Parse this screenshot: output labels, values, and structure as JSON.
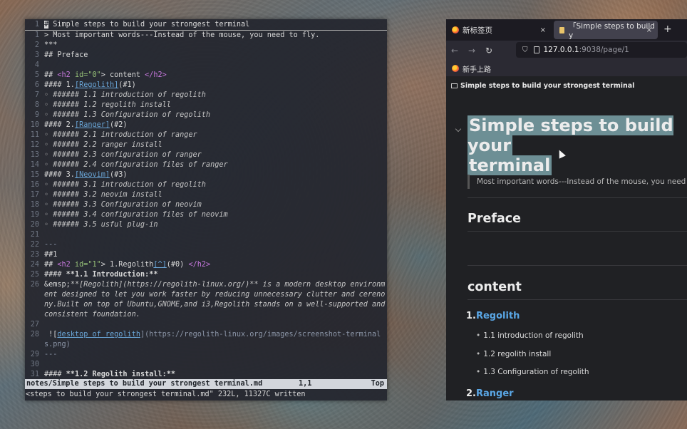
{
  "editor": {
    "lines": [
      {
        "n": "1",
        "segs": [
          [
            "#",
            "cur"
          ],
          [
            " Simple steps to build your strongest terminal",
            ""
          ]
        ],
        "cursor_line": true
      },
      {
        "n": "1",
        "segs": [
          [
            "> Most important words---Instead of the mouse, you need to fly.",
            ""
          ]
        ]
      },
      {
        "n": "2",
        "segs": [
          [
            "***",
            ""
          ]
        ]
      },
      {
        "n": "3",
        "segs": [
          [
            "## Preface",
            ""
          ]
        ]
      },
      {
        "n": "4",
        "segs": [
          [
            "",
            ""
          ]
        ]
      },
      {
        "n": "5",
        "segs": [
          [
            "## ",
            ""
          ],
          [
            "<h2 ",
            "tag"
          ],
          [
            "id=",
            "attr"
          ],
          [
            "\"0\"",
            "attr"
          ],
          [
            "> content ",
            ""
          ],
          [
            "</h2>",
            "tag"
          ]
        ]
      },
      {
        "n": "6",
        "segs": [
          [
            "#### 1.",
            ""
          ],
          [
            "[Regolith]",
            "link"
          ],
          [
            "(#1)",
            ""
          ]
        ]
      },
      {
        "n": "7",
        "segs": [
          [
            "◦ ###### 1.1 introduction of regolith",
            "ital"
          ]
        ]
      },
      {
        "n": "8",
        "segs": [
          [
            "◦ ###### 1.2 regolith install",
            "ital"
          ]
        ]
      },
      {
        "n": "9",
        "segs": [
          [
            "◦ ###### 1.3 Configuration of regolith",
            "ital"
          ]
        ]
      },
      {
        "n": "10",
        "segs": [
          [
            "#### 2.",
            ""
          ],
          [
            "[Ranger]",
            "link"
          ],
          [
            "(#2)",
            ""
          ]
        ]
      },
      {
        "n": "11",
        "segs": [
          [
            "◦ ###### 2.1 introduction of ranger",
            "ital"
          ]
        ]
      },
      {
        "n": "12",
        "segs": [
          [
            "◦ ###### 2.2 ranger install",
            "ital"
          ]
        ]
      },
      {
        "n": "13",
        "segs": [
          [
            "◦ ###### 2.3 configuration of ranger",
            "ital"
          ]
        ]
      },
      {
        "n": "14",
        "segs": [
          [
            "◦ ###### 2.4 configuration files of ranger",
            "ital"
          ]
        ]
      },
      {
        "n": "15",
        "segs": [
          [
            "#### 3.",
            ""
          ],
          [
            "[Neovim]",
            "link"
          ],
          [
            "(#3)",
            ""
          ]
        ]
      },
      {
        "n": "16",
        "segs": [
          [
            "◦ ###### 3.1 introduction of regolith",
            "ital"
          ]
        ]
      },
      {
        "n": "17",
        "segs": [
          [
            "◦ ###### 3.2 neovim install",
            "ital"
          ]
        ]
      },
      {
        "n": "18",
        "segs": [
          [
            "◦ ###### 3.3 Configuration of neovim",
            "ital"
          ]
        ]
      },
      {
        "n": "19",
        "segs": [
          [
            "◦ ###### 3.4 configuration files of neovim",
            "ital"
          ]
        ]
      },
      {
        "n": "20",
        "segs": [
          [
            "◦ ###### 3.5 usful plug-in",
            "ital"
          ]
        ]
      },
      {
        "n": "21",
        "segs": [
          [
            "",
            ""
          ]
        ]
      },
      {
        "n": "22",
        "segs": [
          [
            "---",
            "dim"
          ]
        ]
      },
      {
        "n": "23",
        "segs": [
          [
            "##1",
            ""
          ]
        ]
      },
      {
        "n": "24",
        "segs": [
          [
            "## ",
            ""
          ],
          [
            "<h2 ",
            "tag"
          ],
          [
            "id=",
            "attr"
          ],
          [
            "\"1\"",
            "attr"
          ],
          [
            "> 1.Regolith",
            ""
          ],
          [
            "[^]",
            "link"
          ],
          [
            "(#0) ",
            ""
          ],
          [
            "</h2>",
            "tag"
          ]
        ]
      },
      {
        "n": "25",
        "segs": [
          [
            "#### ",
            ""
          ],
          [
            "**1.1 Introduction:**",
            "bold"
          ]
        ]
      },
      {
        "n": "26",
        "segs": [
          [
            "&emsp;",
            ""
          ],
          [
            "**[Regolith](https://regolith-linux.org/)** is a modern desktop environment designed to let you work faster by reducing unnecessary clutter and cerenony.Built on top of Ubuntu,GNOME,and i3,Regolith stands on a well-supported and consistent foundation.",
            "ital"
          ]
        ]
      },
      {
        "n": "27",
        "segs": [
          [
            "",
            ""
          ]
        ]
      },
      {
        "n": "28",
        "segs": [
          [
            " ![",
            ""
          ],
          [
            "desktop of regolith",
            "link"
          ],
          [
            "](https://regolith-linux.org/images/screenshot-terminals.png)",
            "dim"
          ]
        ]
      },
      {
        "n": "29",
        "segs": [
          [
            "---",
            "dim"
          ]
        ]
      },
      {
        "n": "30",
        "segs": [
          [
            "",
            ""
          ]
        ]
      },
      {
        "n": "31",
        "segs": [
          [
            "#### ",
            ""
          ],
          [
            "**1.2 Regolith install:**",
            "bold"
          ]
        ]
      }
    ],
    "status_file": "notes/Simple steps to build your strongest terminal.md",
    "status_pos": "1,1",
    "status_scroll": "Top",
    "command_line": "<steps to build your strongest terminal.md\" 232L, 11327C written"
  },
  "browser": {
    "tabs": [
      {
        "label": "新标签页",
        "close": "×"
      },
      {
        "label": "「Simple steps to build y",
        "close": "×"
      }
    ],
    "new_tab": "+",
    "nav": {
      "back": "←",
      "forward": "→",
      "reload": "↻"
    },
    "url": {
      "host": "127.0.0.1",
      "path": ":9038/page/1"
    },
    "bookmark": "新手上路",
    "page": {
      "breadcrumb": "Simple steps to build your strongest terminal",
      "title_line1": "Simple steps to build your",
      "title_line2": "terminal",
      "quote": "Most important words---Instead of the mouse, you need to fly.",
      "preface": "Preface",
      "content": "content",
      "sections": [
        {
          "num": "1.",
          "label": "Regolith"
        },
        {
          "num": "2.",
          "label": "Ranger"
        }
      ],
      "subs": [
        "1.1 introduction of regolith",
        "1.2 regolith install",
        "1.3 Configuration of regolith"
      ]
    }
  }
}
